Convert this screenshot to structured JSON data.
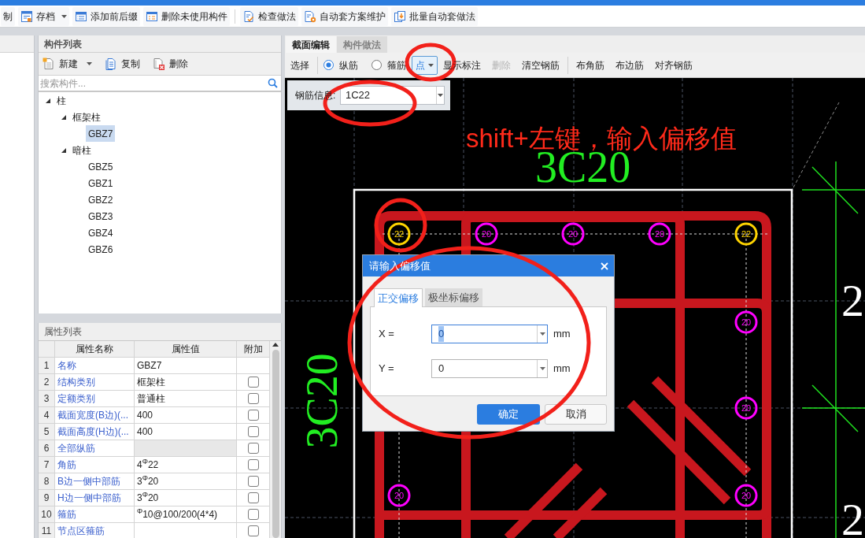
{
  "toolbar": {
    "groups": [
      [
        {
          "label": "制",
          "dropdown": false
        },
        {
          "label": "存档",
          "dropdown": true
        },
        {
          "label": "添加前后缀",
          "dropdown": false
        },
        {
          "label": "删除未使用构件",
          "dropdown": false
        }
      ],
      [
        {
          "label": "检查做法",
          "dropdown": false
        },
        {
          "label": "自动套方案维护",
          "dropdown": false
        },
        {
          "label": "批量自动套做法",
          "dropdown": false
        }
      ]
    ]
  },
  "component_list": {
    "title": "构件列表",
    "actions": [
      {
        "label": "新建",
        "dropdown": true
      },
      {
        "label": "复制",
        "dropdown": false
      },
      {
        "label": "删除",
        "dropdown": false
      }
    ],
    "search": {
      "placeholder": "搜索构件..."
    },
    "tree": [
      {
        "label": "柱",
        "expanded": true,
        "selected": false,
        "children": [
          {
            "label": "框架柱",
            "expanded": true,
            "selected": false,
            "children": [
              {
                "label": "GBZ7",
                "selected": true
              }
            ]
          },
          {
            "label": "暗柱",
            "expanded": true,
            "selected": false,
            "children": [
              {
                "label": "GBZ5",
                "selected": false
              },
              {
                "label": "GBZ1",
                "selected": false
              },
              {
                "label": "GBZ2",
                "selected": false
              },
              {
                "label": "GBZ3",
                "selected": false
              },
              {
                "label": "GBZ4",
                "selected": false
              },
              {
                "label": "GBZ6",
                "selected": false
              }
            ]
          }
        ]
      }
    ]
  },
  "properties": {
    "title": "属性列表",
    "columns": [
      "属性名称",
      "属性值",
      "附加"
    ],
    "rows": [
      {
        "index": "1",
        "name": "名称",
        "value": "GBZ7",
        "disabled": false
      },
      {
        "index": "2",
        "name": "结构类别",
        "value": "框架柱",
        "disabled": false,
        "checked": false
      },
      {
        "index": "3",
        "name": "定额类别",
        "value": "普通柱",
        "disabled": false,
        "checked": false
      },
      {
        "index": "4",
        "name": "截面宽度(B边)(...",
        "value": "400",
        "disabled": false,
        "checked": false
      },
      {
        "index": "5",
        "name": "截面高度(H边)(...",
        "value": "400",
        "disabled": false,
        "checked": false
      },
      {
        "index": "6",
        "name": "全部纵筋",
        "disabled": true,
        "checked": false
      },
      {
        "index": "7",
        "name": "角筋",
        "value": "4$^{Φ}$22",
        "disabled": false,
        "checked": false
      },
      {
        "index": "8",
        "name": "B边一侧中部筋",
        "value": "3$^{Φ}$20",
        "disabled": false,
        "checked": false
      },
      {
        "index": "9",
        "name": "H边一侧中部筋",
        "value": "3$^{Φ}$20",
        "disabled": false,
        "checked": false
      },
      {
        "index": "10",
        "name": "箍筋",
        "value": "$^{Φ}$10@100/200(4*4)",
        "disabled": false,
        "checked": false
      },
      {
        "index": "11",
        "name": "节点区箍筋",
        "disabled": false,
        "checked": false
      }
    ]
  },
  "section_editor": {
    "tabs": [
      {
        "label": "截面编辑",
        "selected": true
      },
      {
        "label": "构件做法",
        "selected": false
      }
    ],
    "toolbar": {
      "groups": [
        [
          {
            "kind": "button",
            "label": "选择",
            "disabled": false
          }
        ],
        [
          {
            "kind": "radio_group",
            "options": [
              {
                "label": "纵筋",
                "selected": true
              },
              {
                "label": "箍筋",
                "selected": false
              }
            ]
          },
          {
            "kind": "dropdown",
            "label": "点"
          },
          {
            "kind": "button",
            "label": "显示标注",
            "disabled": false
          },
          {
            "kind": "button",
            "label": "删除",
            "disabled": true
          },
          {
            "kind": "button",
            "label": "清空钢筋",
            "disabled": false
          }
        ],
        [
          {
            "kind": "button",
            "label": "布角筋",
            "disabled": false
          },
          {
            "kind": "button",
            "label": "布边筋",
            "disabled": false
          },
          {
            "kind": "button",
            "label": "对齐钢筋",
            "disabled": false
          }
        ]
      ]
    }
  },
  "rebar_info": {
    "label": "钢筋信息:",
    "value": "1C22"
  },
  "canvas": {
    "annotation": "shift+左键，输入偏移值",
    "top_label": "3C20",
    "left_label": "3C20",
    "right_labels": [
      "2",
      "2"
    ],
    "rebars": [
      {
        "label": "22",
        "color": "#ffd400"
      },
      {
        "label": "20",
        "color": "#ff00ff"
      },
      {
        "label": "20",
        "color": "#ff00ff"
      },
      {
        "label": "20",
        "color": "#ff00ff"
      },
      {
        "label": "22",
        "color": "#ffd400"
      },
      {
        "label": "20",
        "color": "#ff00ff"
      },
      {
        "label": "20",
        "color": "#ff00ff"
      },
      {
        "label": "20",
        "color": "#ff00ff"
      },
      {
        "label": "20",
        "color": "#ff00ff"
      }
    ]
  },
  "dialog": {
    "title": "请输入偏移值",
    "tabs": [
      {
        "label": "正交偏移",
        "selected": true
      },
      {
        "label": "极坐标偏移",
        "selected": false
      }
    ],
    "fields": [
      {
        "label": "X =",
        "value": "0",
        "unit": "mm",
        "focused": true
      },
      {
        "label": "Y =",
        "value": "0",
        "unit": "mm",
        "focused": false
      }
    ],
    "buttons": [
      {
        "label": "确定",
        "primary": true
      },
      {
        "label": "取消",
        "primary": false
      }
    ]
  }
}
